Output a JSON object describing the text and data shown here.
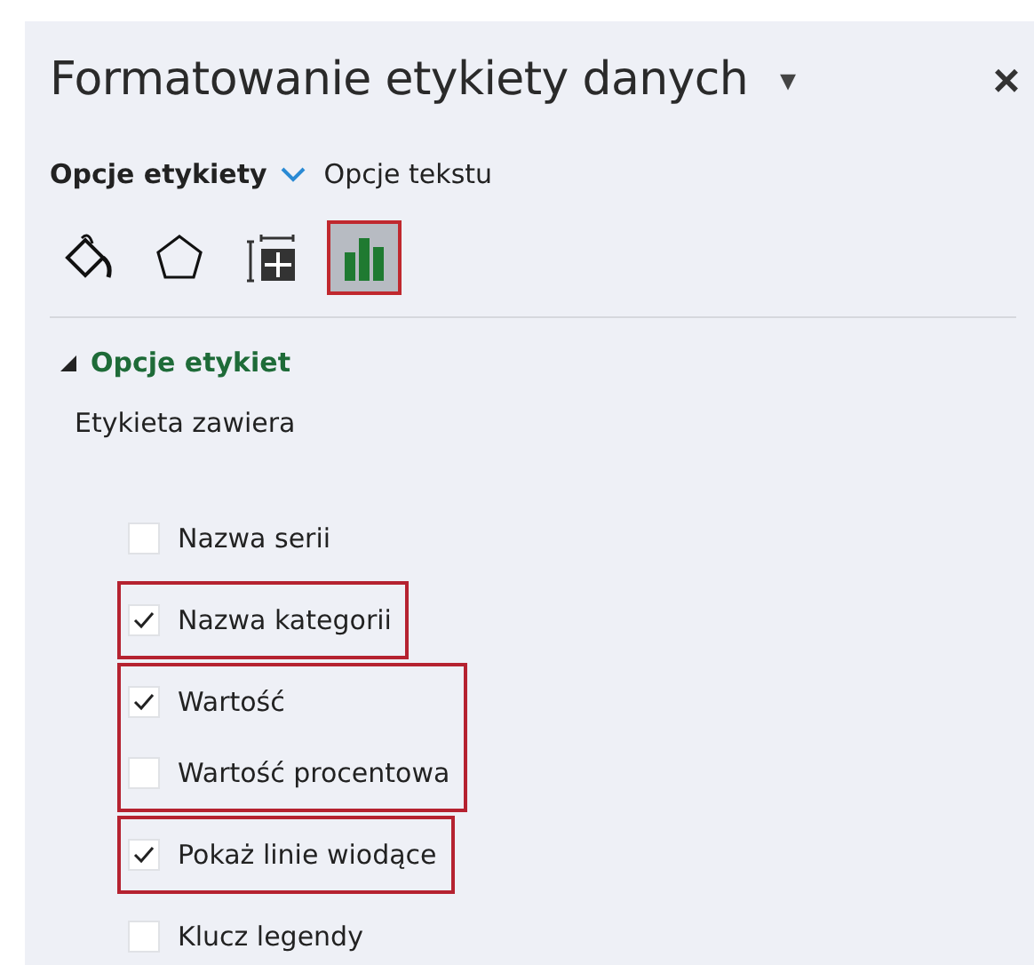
{
  "pane": {
    "title": "Formatowanie etykiety danych",
    "menu_glyph": "▾",
    "close_glyph": "×"
  },
  "tabs": [
    {
      "label": "Opcje etykiety",
      "selected": true
    },
    {
      "label": "Opcje tekstu",
      "selected": false
    }
  ],
  "icon_tabs": [
    {
      "kind": "fill",
      "selected": false,
      "highlighted": false
    },
    {
      "kind": "effects",
      "selected": false,
      "highlighted": false
    },
    {
      "kind": "size",
      "selected": false,
      "highlighted": false
    },
    {
      "kind": "chart",
      "selected": true,
      "highlighted": true
    }
  ],
  "section": {
    "title": "Opcje etykiet",
    "expanded": true,
    "subtitle": "Etykieta zawiera"
  },
  "option_groups": [
    {
      "highlighted": false,
      "options": [
        {
          "label": "Nazwa serii",
          "checked": false
        }
      ]
    },
    {
      "highlighted": true,
      "options": [
        {
          "label": "Nazwa kategorii",
          "checked": true
        }
      ]
    },
    {
      "highlighted": true,
      "options": [
        {
          "label": "Wartość",
          "checked": true
        },
        {
          "label": "Wartość procentowa",
          "checked": false
        }
      ]
    },
    {
      "highlighted": true,
      "options": [
        {
          "label": "Pokaż linie wiodące",
          "checked": true
        }
      ]
    },
    {
      "highlighted": false,
      "options": [
        {
          "label": "Klucz legendy",
          "checked": false
        }
      ]
    }
  ]
}
